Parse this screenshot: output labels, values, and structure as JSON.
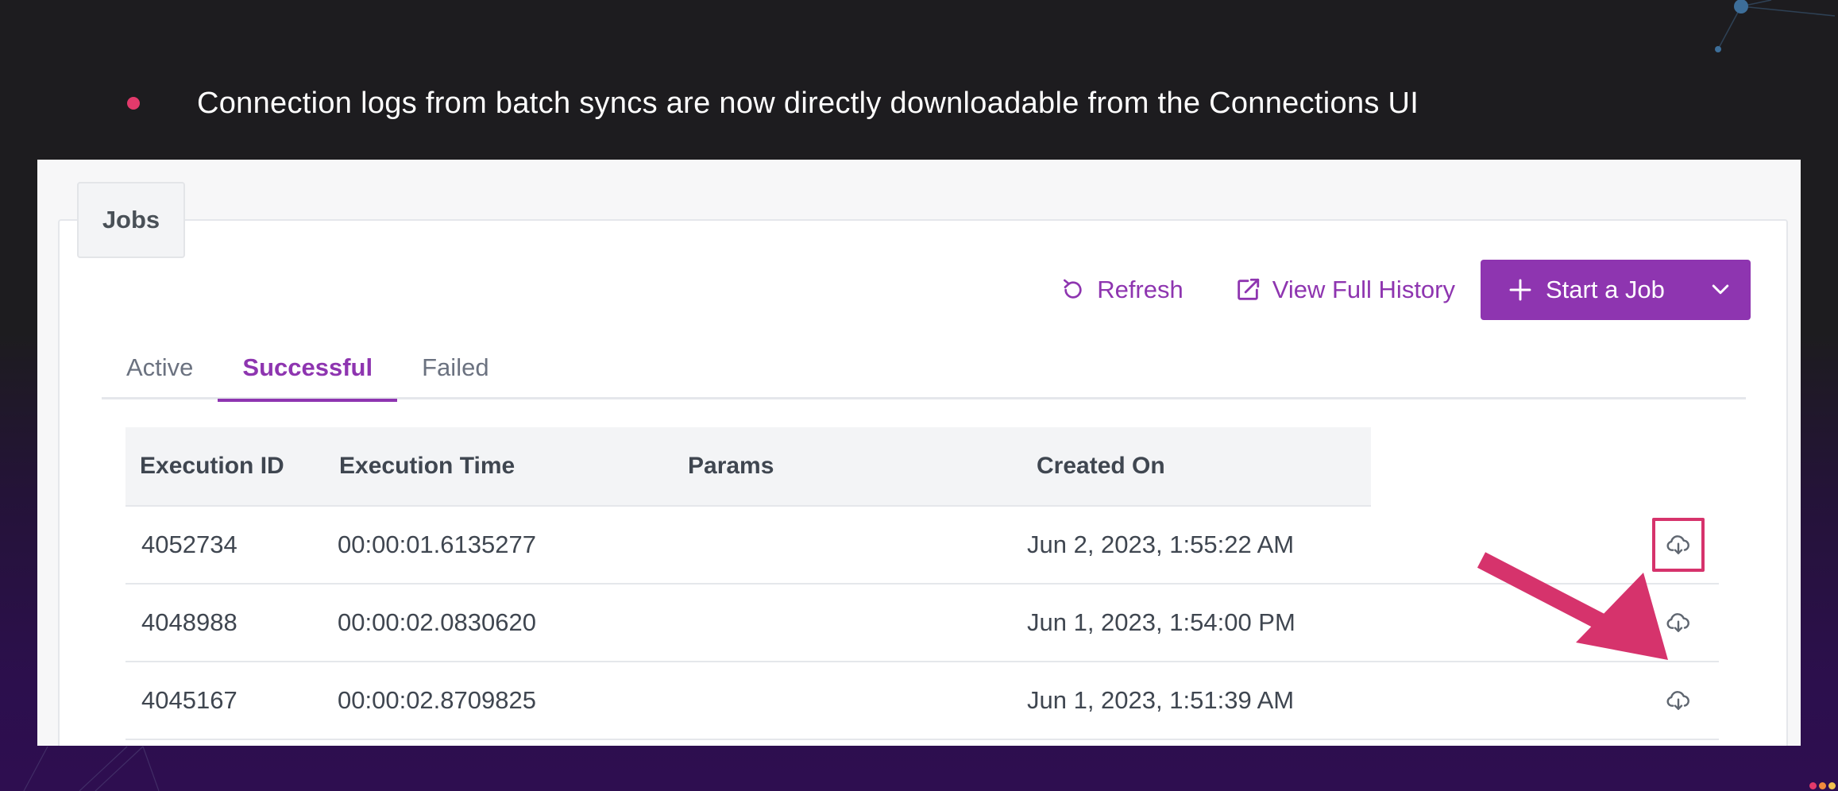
{
  "slide": {
    "bullet_text": "Connection logs from batch syncs are now directly downloadable from the Connections UI"
  },
  "jobs_tab": {
    "label": "Jobs"
  },
  "toolbar": {
    "refresh_label": "Refresh",
    "view_history_label": "View Full History",
    "start_job_label": "Start a Job"
  },
  "tabs": [
    {
      "label": "Active",
      "active": false
    },
    {
      "label": "Successful",
      "active": true
    },
    {
      "label": "Failed",
      "active": false
    }
  ],
  "table": {
    "columns": [
      "Execution ID",
      "Execution Time",
      "Params",
      "Created On"
    ],
    "rows": [
      {
        "id": "4052734",
        "time": "00:00:01.6135277",
        "params": "",
        "created": "Jun 2, 2023, 1:55:22 AM",
        "highlighted": true
      },
      {
        "id": "4048988",
        "time": "00:00:02.0830620",
        "params": "",
        "created": "Jun 1, 2023, 1:54:00 PM",
        "highlighted": false
      },
      {
        "id": "4045167",
        "time": "00:00:02.8709825",
        "params": "",
        "created": "Jun 1, 2023, 1:51:39 AM",
        "highlighted": false
      }
    ]
  },
  "icons": {
    "refresh": "refresh-icon",
    "external": "external-link-icon",
    "plus": "plus-icon",
    "caret": "chevron-down-icon",
    "download": "cloud-download-icon"
  },
  "colors": {
    "accent": "#8e35b0",
    "highlight": "#d6336c",
    "bullet": "#e23a6b"
  }
}
